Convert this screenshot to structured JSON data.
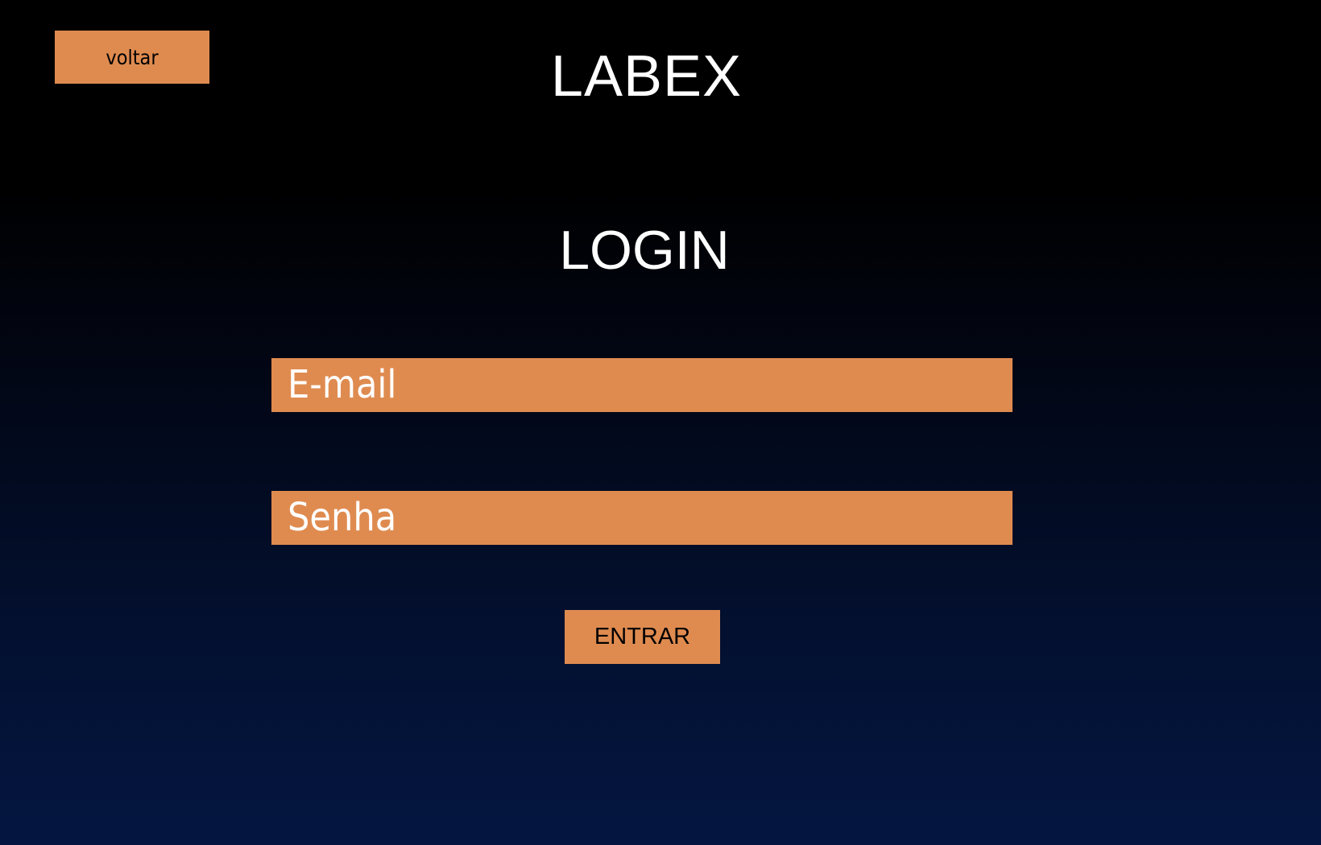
{
  "colors": {
    "accent": "#df8b50",
    "background_top": "#000000",
    "background_bottom": "#041641",
    "title_text": "#ffffff",
    "button_text": "#000000"
  },
  "header": {
    "back_label": "voltar",
    "app_title": "LABEX"
  },
  "login": {
    "title": "LOGIN",
    "email_placeholder": "E-mail",
    "password_placeholder": "Senha",
    "submit_label": "ENTRAR"
  }
}
